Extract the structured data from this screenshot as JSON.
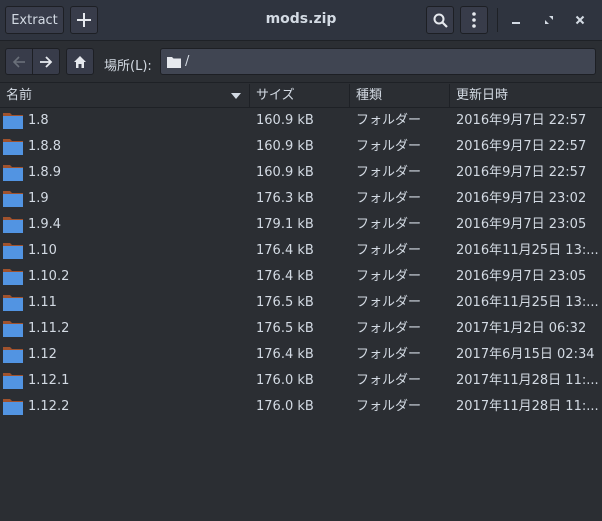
{
  "header": {
    "extract_label": "Extract",
    "add_icon": "plus-icon",
    "title": "mods.zip",
    "search_icon": "search-icon",
    "menu_icon": "kebab-menu-icon",
    "window_controls": [
      "minimize-icon",
      "maximize-icon",
      "close-icon"
    ]
  },
  "location": {
    "back_icon": "arrow-left-icon",
    "forward_icon": "arrow-right-icon",
    "home_icon": "home-icon",
    "label": "場所(L):",
    "path": "/"
  },
  "columns": {
    "name": "名前",
    "size": "サイズ",
    "type": "種類",
    "modified": "更新日時"
  },
  "rows": [
    {
      "name": "1.8",
      "size": "160.9 kB",
      "type": "フォルダー",
      "modified": "2016年9月7日 22:57"
    },
    {
      "name": "1.8.8",
      "size": "160.9 kB",
      "type": "フォルダー",
      "modified": "2016年9月7日 22:57"
    },
    {
      "name": "1.8.9",
      "size": "160.9 kB",
      "type": "フォルダー",
      "modified": "2016年9月7日 22:57"
    },
    {
      "name": "1.9",
      "size": "176.3 kB",
      "type": "フォルダー",
      "modified": "2016年9月7日 23:02"
    },
    {
      "name": "1.9.4",
      "size": "179.1 kB",
      "type": "フォルダー",
      "modified": "2016年9月7日 23:05"
    },
    {
      "name": "1.10",
      "size": "176.4 kB",
      "type": "フォルダー",
      "modified": "2016年11月25日 13:..."
    },
    {
      "name": "1.10.2",
      "size": "176.4 kB",
      "type": "フォルダー",
      "modified": "2016年9月7日 23:05"
    },
    {
      "name": "1.11",
      "size": "176.5 kB",
      "type": "フォルダー",
      "modified": "2016年11月25日 13:..."
    },
    {
      "name": "1.11.2",
      "size": "176.5 kB",
      "type": "フォルダー",
      "modified": "2017年1月2日 06:32"
    },
    {
      "name": "1.12",
      "size": "176.4 kB",
      "type": "フォルダー",
      "modified": "2017年6月15日 02:34"
    },
    {
      "name": "1.12.1",
      "size": "176.0 kB",
      "type": "フォルダー",
      "modified": "2017年11月28日 11:..."
    },
    {
      "name": "1.12.2",
      "size": "176.0 kB",
      "type": "フォルダー",
      "modified": "2017年11月28日 11:..."
    }
  ],
  "colors": {
    "folder_body": "#5294e2",
    "folder_tab": "#a0522d",
    "background": "#2b2e33"
  }
}
